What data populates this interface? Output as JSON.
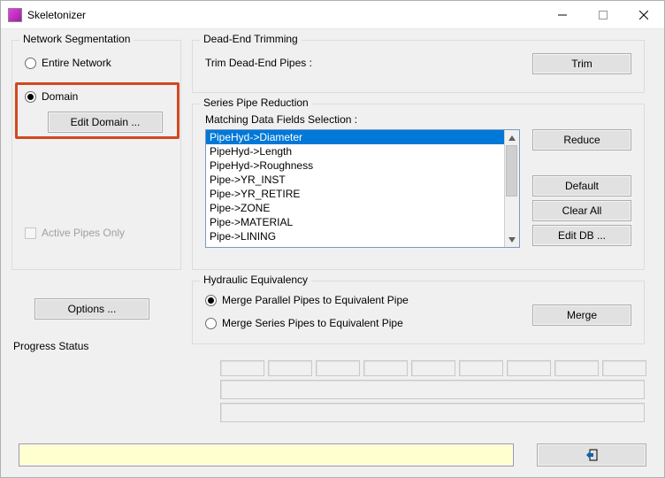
{
  "window": {
    "title": "Skeletonizer"
  },
  "network_segmentation": {
    "caption": "Network Segmentation",
    "options": {
      "entire_network": {
        "label": "Entire Network",
        "checked": false
      },
      "domain": {
        "label": "Domain",
        "checked": true
      }
    },
    "edit_domain_button": "Edit Domain ...",
    "active_pipes_only": {
      "label": "Active Pipes Only",
      "checked": false,
      "enabled": false
    }
  },
  "dead_end": {
    "caption": "Dead-End Trimming",
    "label": "Trim Dead-End Pipes :",
    "trim_button": "Trim"
  },
  "series_pipe": {
    "caption": "Series Pipe Reduction",
    "field_label": "Matching Data Fields Selection :",
    "items": [
      "PipeHyd->Diameter",
      "PipeHyd->Length",
      "PipeHyd->Roughness",
      "Pipe->YR_INST",
      "Pipe->YR_RETIRE",
      "Pipe->ZONE",
      "Pipe->MATERIAL",
      "Pipe->LINING"
    ],
    "selected_index": 0,
    "buttons": {
      "reduce": "Reduce",
      "default": "Default",
      "clear_all": "Clear All",
      "edit_db": "Edit DB ..."
    }
  },
  "hydraulic": {
    "caption": "Hydraulic Equivalency",
    "options": {
      "merge_parallel": {
        "label": "Merge Parallel Pipes to Equivalent Pipe",
        "checked": true
      },
      "merge_series": {
        "label": "Merge Series Pipes to Equivalent Pipe",
        "checked": false
      }
    },
    "merge_button": "Merge"
  },
  "options_button": "Options ...",
  "progress": {
    "caption": "Progress Status"
  }
}
